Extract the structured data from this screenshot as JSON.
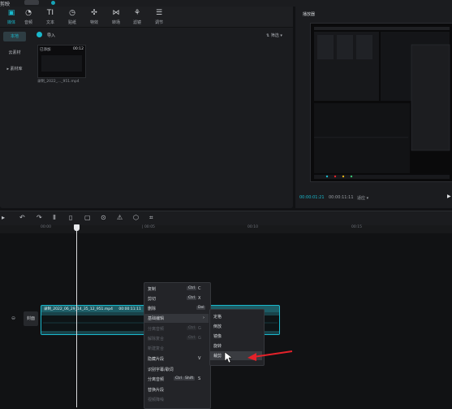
{
  "app": {
    "title": "剪映",
    "tag": "",
    "faded_title": ""
  },
  "toolbar": {
    "items": [
      {
        "icon": "media-icon",
        "label": "媒体",
        "active": true
      },
      {
        "icon": "audio-icon",
        "label": "音频"
      },
      {
        "icon": "text-icon",
        "label": "文本"
      },
      {
        "icon": "sticker-icon",
        "label": "贴纸"
      },
      {
        "icon": "effects-icon",
        "label": "特效"
      },
      {
        "icon": "transition-icon",
        "label": "转场"
      },
      {
        "icon": "filter-icon",
        "label": "滤镜"
      },
      {
        "icon": "adjust-icon",
        "label": "调节"
      }
    ]
  },
  "sidebar": {
    "items": [
      {
        "label": "本地",
        "active": true
      },
      {
        "label": "云素材"
      },
      {
        "label": "▸ 素材库"
      }
    ]
  },
  "media": {
    "import_label": "导入",
    "sort_label": "⇅ 筛选 ▾",
    "clip": {
      "badge": "已添加",
      "duration": "00:12",
      "filename": "录制_2022_..._951.mp4"
    }
  },
  "preview": {
    "title": "播放器",
    "current_time": "00:00:01:21",
    "total_time": "00:00:11:11",
    "ratio": "适应 ▾",
    "play_icon": "play-icon"
  },
  "timeline": {
    "ruler_ticks": [
      "00:00",
      "| 00:05",
      "00:10",
      "00:15"
    ],
    "track": {
      "cover_label": "封面",
      "clip_name": "录制_2022_06_29_14_35_12_951.mp4",
      "clip_duration": "00:00:11:11"
    }
  },
  "context_menu": {
    "items": [
      {
        "label": "复制",
        "kbd": "Ctrl",
        "key": "C"
      },
      {
        "label": "剪切",
        "kbd": "Ctrl",
        "key": "X"
      },
      {
        "label": "删除",
        "kbd": "Del",
        "key": ""
      },
      {
        "label": "基础编辑",
        "kbd": "",
        "key": "›"
      },
      {
        "label": "分离音频",
        "kbd": "Ctrl",
        "key": "G",
        "disabled": true
      },
      {
        "label": "解除复合",
        "kbd": "Ctrl",
        "key": "G",
        "disabled": true
      },
      {
        "label": "新建复合",
        "kbd": "",
        "key": "",
        "disabled": true
      },
      {
        "label": "隐藏片段",
        "kbd": "",
        "key": "V"
      },
      {
        "label": "识别字幕/歌词",
        "kbd": "",
        "key": ""
      },
      {
        "label": "分离音频",
        "kbd": "Ctrl",
        "key": "S",
        "kbd2": "Shift"
      },
      {
        "label": "替换片段",
        "kbd": "",
        "key": ""
      },
      {
        "label": "视频降噪",
        "kbd": "",
        "key": "",
        "disabled": true
      }
    ]
  },
  "submenu": {
    "items": [
      "定格",
      "倒放",
      "镜像",
      "旋转",
      "裁剪"
    ]
  },
  "colors": {
    "accent": "#19b8cc",
    "arrow": "#e3222a"
  }
}
